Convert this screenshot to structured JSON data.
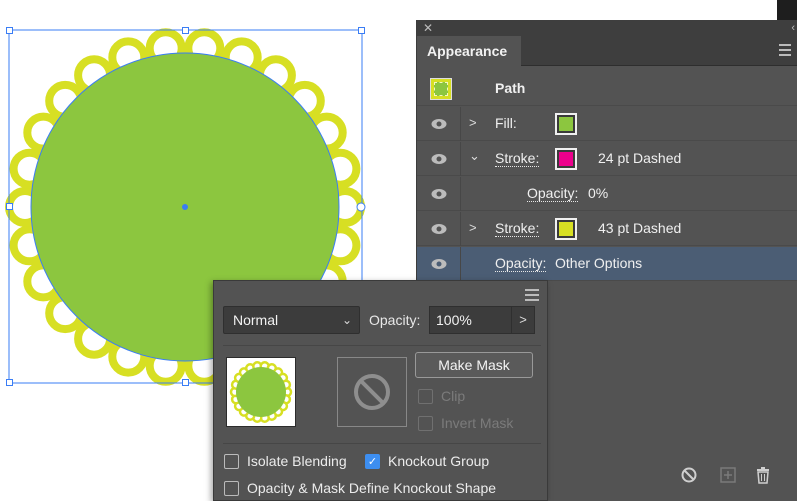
{
  "appearance_panel": {
    "tab_title": "Appearance",
    "header_label": "Path",
    "rows": [
      {
        "label": "Fill:",
        "value": "",
        "swatch": "#8cc63f",
        "expanded": false
      },
      {
        "label": "Stroke:",
        "value": "24 pt Dashed",
        "swatch": "#ec008c",
        "expanded": true
      },
      {
        "label": "Opacity:",
        "value": "0%"
      },
      {
        "label": "Stroke:",
        "value": "43 pt Dashed",
        "swatch": "#d7df23",
        "expanded": false
      },
      {
        "label": "Opacity:",
        "value": "Other Options",
        "selected": true
      }
    ],
    "icons": [
      "close-icon",
      "panel-menu-icon",
      "eye-icon",
      "chevron-right-icon",
      "chevron-down-icon",
      "no-icon",
      "add-new-icon",
      "trash-icon"
    ]
  },
  "transparency_popup": {
    "blend_mode": "Normal",
    "opacity_label": "Opacity:",
    "opacity_value": "100%",
    "make_mask_label": "Make Mask",
    "clip_label": "Clip",
    "invert_mask_label": "Invert Mask",
    "isolate_blending_label": "Isolate Blending",
    "knockout_group_label": "Knockout Group",
    "opacity_mask_label": "Opacity & Mask Define Knockout Shape",
    "isolate_blending": false,
    "knockout_group": true,
    "opacity_mask_knockout": false
  },
  "colors": {
    "fill_green": "#8cc63f",
    "stroke_yellow": "#d7df23",
    "stroke_magenta": "#ec008c",
    "selection_blue": "#3a7df5"
  }
}
